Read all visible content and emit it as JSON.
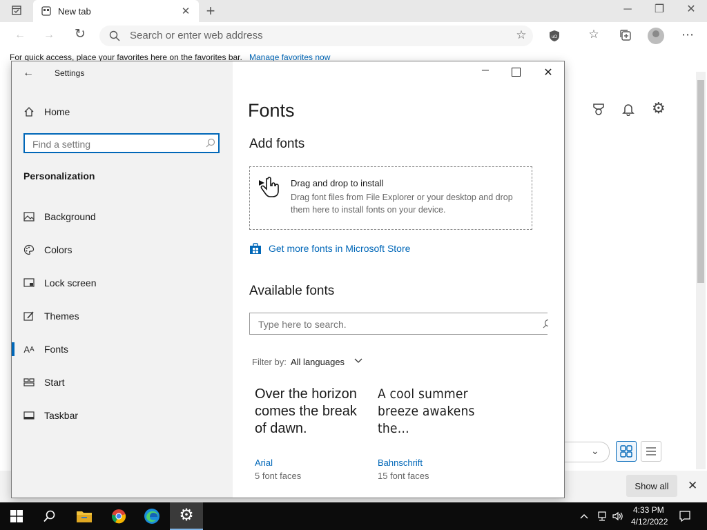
{
  "browser": {
    "tab_title": "New tab",
    "address_placeholder": "Search or enter web address",
    "favorites_bar_text": "For quick access, place your favorites here on the favorites bar.",
    "favorites_bar_link": "Manage favorites now",
    "show_all_label": "Show all"
  },
  "settings": {
    "window_title": "Settings",
    "home_label": "Home",
    "search_placeholder": "Find a setting",
    "section_title": "Personalization",
    "nav_items": [
      {
        "label": "Background",
        "icon": "image-icon"
      },
      {
        "label": "Colors",
        "icon": "palette-icon"
      },
      {
        "label": "Lock screen",
        "icon": "lock-screen-icon"
      },
      {
        "label": "Themes",
        "icon": "themes-icon"
      },
      {
        "label": "Fonts",
        "icon": "fonts-icon",
        "selected": true
      },
      {
        "label": "Start",
        "icon": "start-icon"
      },
      {
        "label": "Taskbar",
        "icon": "taskbar-icon"
      }
    ],
    "page_title": "Fonts",
    "add_fonts_heading": "Add fonts",
    "drop_title": "Drag and drop to install",
    "drop_desc": "Drag font files from File Explorer or your desktop and drop them here to install fonts on your device.",
    "store_link": "Get more fonts in Microsoft Store",
    "available_heading": "Available fonts",
    "font_search_placeholder": "Type here to search.",
    "filter_label": "Filter by:",
    "filter_value": "All languages",
    "fonts": [
      {
        "preview": "Over the horizon comes the break of dawn.",
        "name": "Arial",
        "faces": "5 font faces"
      },
      {
        "preview": "A cool summer breeze awakens the…",
        "name": "Bahnschrift",
        "faces": "15 font faces"
      }
    ]
  },
  "taskbar": {
    "time": "4:33 PM",
    "date": "4/12/2022"
  },
  "colors": {
    "accent": "#0067b8",
    "taskbar": "#0c0c0c"
  }
}
